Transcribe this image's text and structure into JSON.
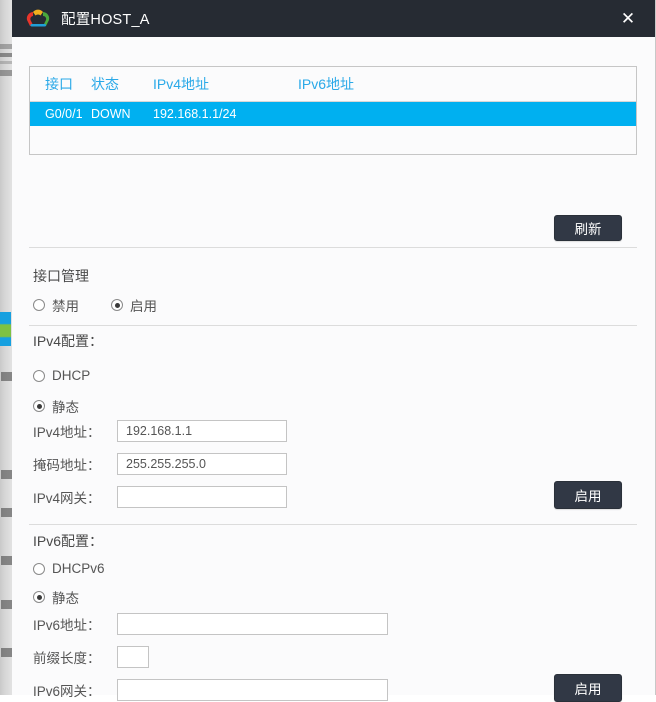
{
  "window": {
    "title": "配置HOST_A",
    "icon": "cloud-icon",
    "close_label": "✕"
  },
  "interface_table": {
    "columns": [
      "接口",
      "状态",
      "IPv4地址",
      "IPv6地址"
    ],
    "rows": [
      {
        "interface": "G0/0/1",
        "status": "DOWN",
        "ipv4": "192.168.1.1/24",
        "ipv6": "",
        "selected": true
      }
    ],
    "refresh_label": "刷新"
  },
  "interface_management": {
    "title": "接口管理",
    "options": [
      {
        "label": "禁用",
        "selected": false
      },
      {
        "label": "启用",
        "selected": true
      }
    ]
  },
  "ipv4": {
    "title": "IPv4配置：",
    "mode_options": [
      {
        "label": "DHCP",
        "selected": false
      },
      {
        "label": "静态",
        "selected": true
      }
    ],
    "fields": [
      {
        "label": "IPv4地址：",
        "value": "192.168.1.1",
        "placeholder": ""
      },
      {
        "label": "掩码地址：",
        "value": "255.255.255.0",
        "placeholder": ""
      },
      {
        "label": "IPv4网关：",
        "value": "",
        "placeholder": ""
      }
    ],
    "apply_label": "启用"
  },
  "ipv6": {
    "title": "IPv6配置：",
    "mode_options": [
      {
        "label": "DHCPv6",
        "selected": false
      },
      {
        "label": "静态",
        "selected": true
      }
    ],
    "fields": [
      {
        "label": "IPv6地址：",
        "value": "",
        "placeholder": ""
      },
      {
        "label": "前缀长度：",
        "value": "",
        "placeholder": ""
      },
      {
        "label": "IPv6网关：",
        "value": "",
        "placeholder": ""
      }
    ],
    "apply_label": "启用"
  },
  "colors": {
    "titlebar": "#262b33",
    "accent_blue": "#00b0f0",
    "header_text_blue": "#2aa9e8",
    "button_dark": "#313845",
    "dialog_bg": "#fbfbfc"
  }
}
